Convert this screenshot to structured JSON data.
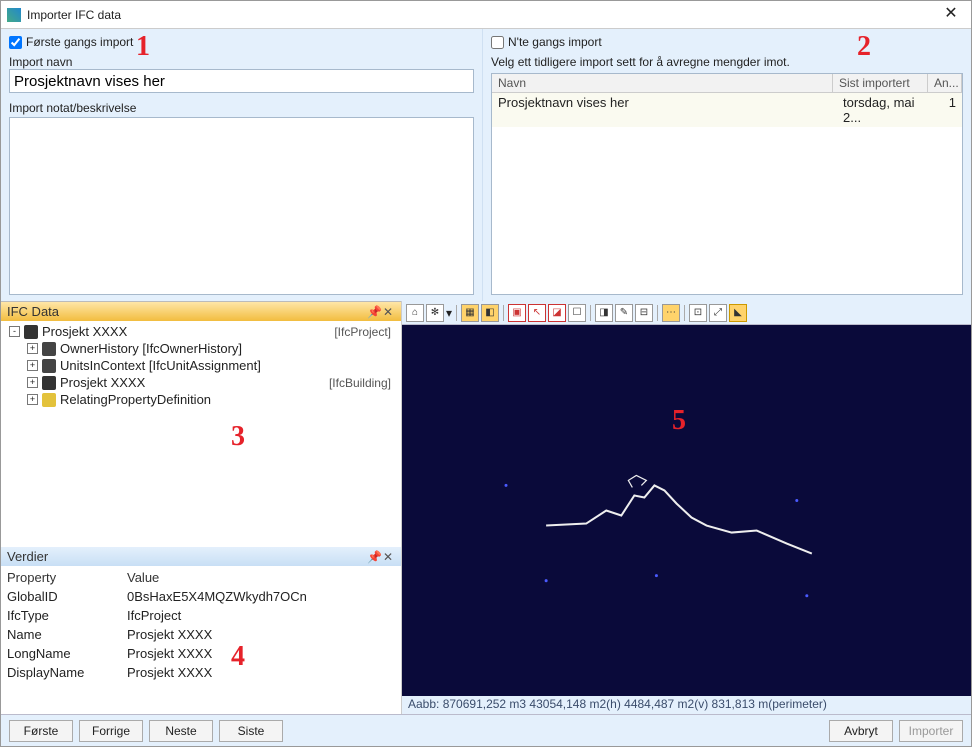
{
  "window": {
    "title": "Importer IFC data"
  },
  "annotations": {
    "n1": "1",
    "n2": "2",
    "n3": "3",
    "n4": "4",
    "n5": "5"
  },
  "left": {
    "checkbox_label": "Første gangs import",
    "import_name_label": "Import navn",
    "import_name_value": "Prosjektnavn vises her",
    "notes_label": "Import notat/beskrivelse",
    "notes_value": ""
  },
  "right": {
    "checkbox_label": "N'te gangs import",
    "subtitle": "Velg ett tidligere import sett for å avregne mengder imot.",
    "cols": {
      "name": "Navn",
      "last": "Sist importert",
      "count": "An..."
    },
    "rows": [
      {
        "name": "Prosjektnavn vises her",
        "last": "torsdag, mai 2...",
        "count": "1"
      }
    ]
  },
  "ifc_panel": {
    "title": "IFC Data",
    "nodes": [
      {
        "depth": 0,
        "exp": "-",
        "icon": "#333",
        "label": "Prosjekt XXXX",
        "tag": "[IfcProject]"
      },
      {
        "depth": 1,
        "exp": "+",
        "icon": "#444",
        "label": "OwnerHistory [IfcOwnerHistory]",
        "tag": ""
      },
      {
        "depth": 1,
        "exp": "+",
        "icon": "#444",
        "label": "UnitsInContext [IfcUnitAssignment]",
        "tag": ""
      },
      {
        "depth": 1,
        "exp": "+",
        "icon": "#333",
        "label": "Prosjekt XXXX",
        "tag": "[IfcBuilding]"
      },
      {
        "depth": 1,
        "exp": "+",
        "icon": "#e3c23b",
        "label": "RelatingPropertyDefinition",
        "tag": ""
      }
    ]
  },
  "verdier_panel": {
    "title": "Verdier",
    "header_k": "Property",
    "header_v": "Value",
    "rows": [
      {
        "k": "GlobalID",
        "v": "0BsHaxE5X4MQZWkydh7OCn"
      },
      {
        "k": "IfcType",
        "v": "IfcProject"
      },
      {
        "k": "Name",
        "v": "Prosjekt XXXX"
      },
      {
        "k": "LongName",
        "v": "Prosjekt XXXX"
      },
      {
        "k": "DisplayName",
        "v": "Prosjekt XXXX"
      }
    ]
  },
  "viewer": {
    "status": "Aabb:  870691,252 m3   43054,148 m2(h)   4484,487 m2(v)   831,813 m(perimeter)"
  },
  "footer": {
    "first": "Første",
    "prev": "Forrige",
    "next": "Neste",
    "last": "Siste",
    "cancel": "Avbryt",
    "import": "Importer"
  }
}
